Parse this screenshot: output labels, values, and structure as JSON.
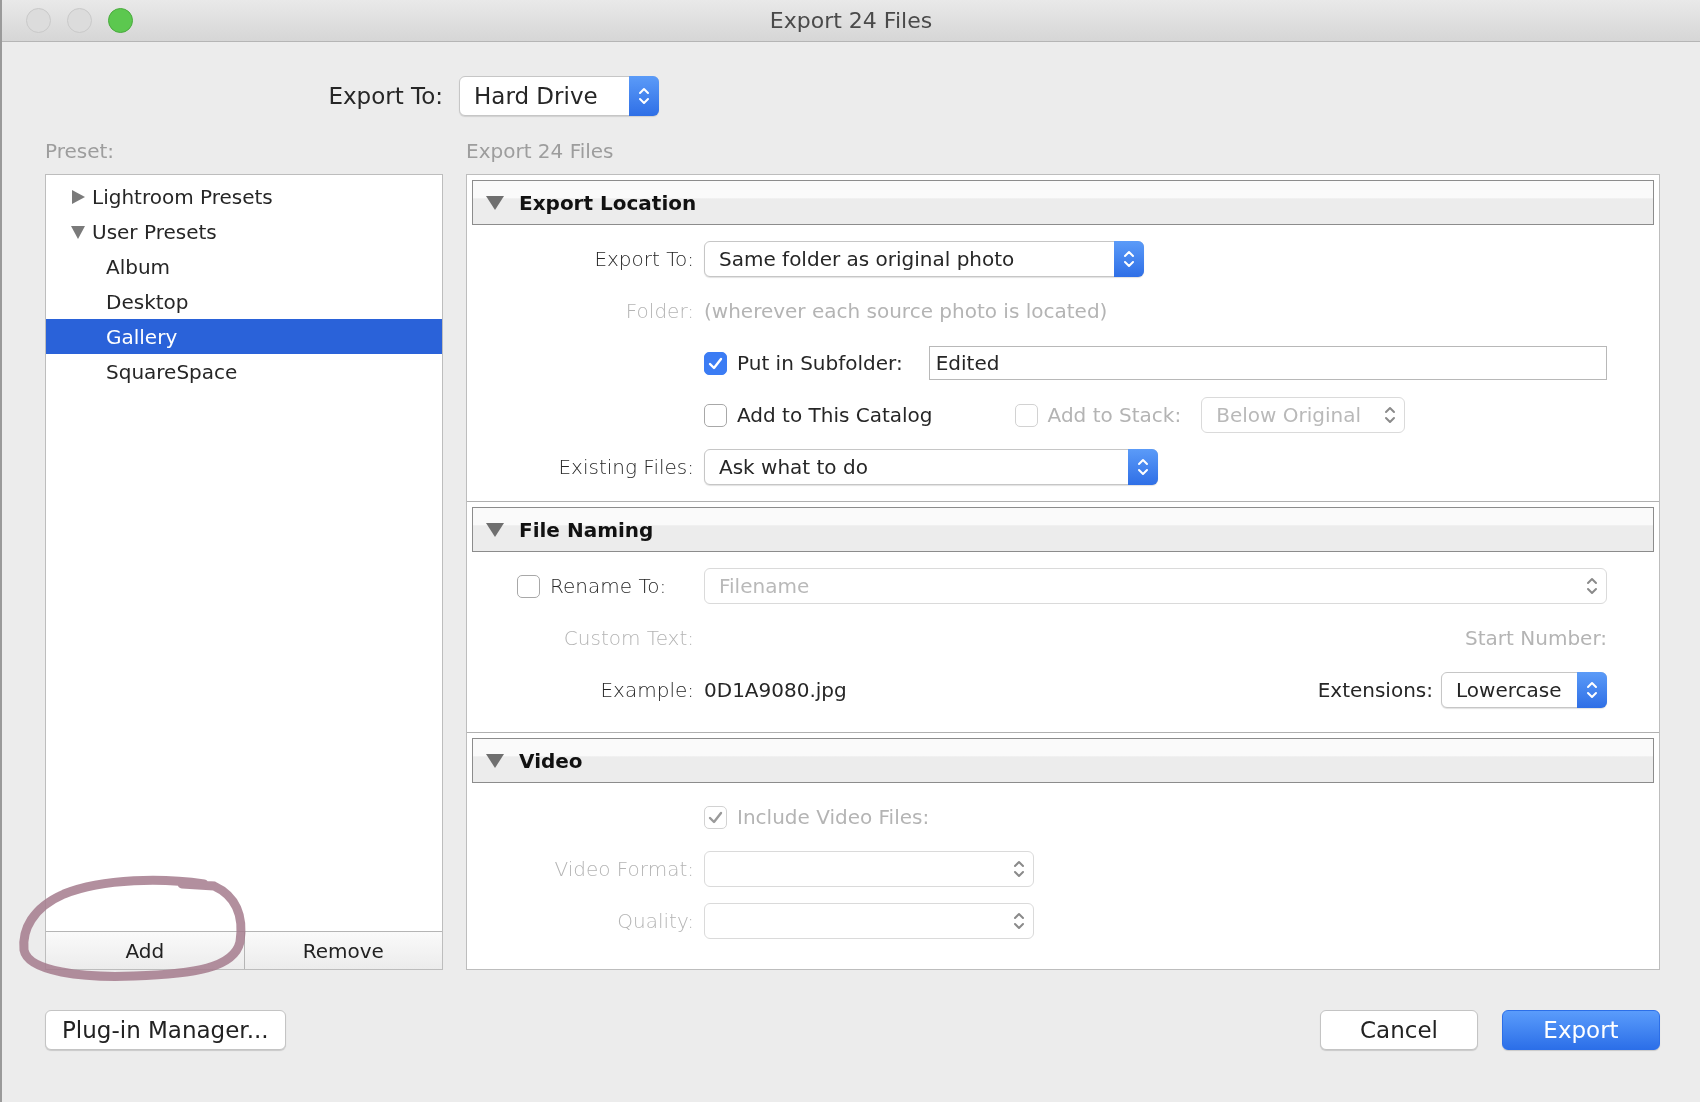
{
  "window": {
    "title": "Export 24 Files"
  },
  "export_to": {
    "label": "Export To:",
    "value": "Hard Drive"
  },
  "preset": {
    "caption": "Preset:",
    "tree": [
      {
        "label": "Lightroom Presets",
        "expanded": false,
        "selected": false
      },
      {
        "label": "User Presets",
        "expanded": true,
        "selected": false,
        "children": [
          {
            "label": "Album",
            "selected": false
          },
          {
            "label": "Desktop",
            "selected": false
          },
          {
            "label": "Gallery",
            "selected": true
          },
          {
            "label": "SquareSpace",
            "selected": false
          }
        ]
      }
    ],
    "buttons": [
      "Add",
      "Remove"
    ]
  },
  "panel": {
    "caption": "Export 24 Files",
    "sections": [
      {
        "title": "Export Location",
        "expanded": true,
        "rows": [
          {
            "lead": {
              "kind": "label",
              "text": "Export To:"
            },
            "left": [
              {
                "kind": "select",
                "value": "Same folder as original photo",
                "disabled": false
              }
            ]
          },
          {
            "lead": {
              "kind": "label",
              "text": "Folder:",
              "disabled": true
            },
            "left": [
              {
                "kind": "text",
                "text": "(wherever each source photo is located)",
                "disabled": true
              }
            ]
          },
          {
            "left": [
              {
                "kind": "checkbox",
                "text": "Put in Subfolder:",
                "checked": true,
                "disabled": false
              },
              {
                "kind": "field",
                "value": "Edited"
              }
            ]
          },
          {
            "left": [
              {
                "kind": "checkbox",
                "text": "Add to This Catalog",
                "checked": false,
                "disabled": false
              },
              {
                "kind": "checkbox",
                "text": "Add to Stack:",
                "checked": false,
                "disabled": true
              },
              {
                "kind": "select",
                "value": "Below Original",
                "disabled": true
              }
            ]
          },
          {
            "lead": {
              "kind": "label",
              "text": "Existing Files:"
            },
            "left": [
              {
                "kind": "select",
                "value": "Ask what to do",
                "disabled": false
              }
            ]
          }
        ]
      },
      {
        "title": "File Naming",
        "expanded": true,
        "rows": [
          {
            "lead": {
              "kind": "checkbox",
              "text": "Rename To:",
              "checked": false,
              "disabled": false
            },
            "left": [
              {
                "kind": "select",
                "value": "Filename",
                "disabled": true
              }
            ]
          },
          {
            "lead": {
              "kind": "label",
              "text": "Custom Text:",
              "disabled": true
            },
            "right": [
              {
                "kind": "label",
                "text": "Start Number:",
                "disabled": true
              }
            ]
          },
          {
            "lead": {
              "kind": "label",
              "text": "Example:"
            },
            "left": [
              {
                "kind": "text",
                "text": "0D1A9080.jpg"
              }
            ],
            "right": [
              {
                "kind": "label",
                "text": "Extensions:"
              },
              {
                "kind": "select",
                "value": "Lowercase",
                "disabled": false
              }
            ]
          }
        ]
      },
      {
        "title": "Video",
        "expanded": true,
        "rows": [
          {
            "left": [
              {
                "kind": "checkbox",
                "text": "Include Video Files:",
                "checked": true,
                "disabled": true
              }
            ]
          },
          {
            "lead": {
              "kind": "label",
              "text": "Video Format:",
              "disabled": true
            },
            "left": [
              {
                "kind": "select",
                "disabled": true
              }
            ]
          },
          {
            "lead": {
              "kind": "label",
              "text": "Quality:",
              "disabled": true
            },
            "left": [
              {
                "kind": "select",
                "disabled": true
              }
            ]
          }
        ]
      }
    ]
  },
  "footer": {
    "plugin": "Plug-in Manager...",
    "cancel": "Cancel",
    "export": "Export"
  }
}
